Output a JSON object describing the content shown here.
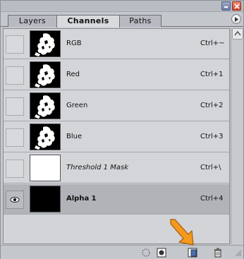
{
  "tabs": [
    {
      "label": "Layers"
    },
    {
      "label": "Channels"
    },
    {
      "label": "Paths"
    }
  ],
  "channels": [
    {
      "name": "RGB",
      "shortcut": "Ctrl+~",
      "thumb": "silhouette"
    },
    {
      "name": "Red",
      "shortcut": "Ctrl+1",
      "thumb": "silhouette"
    },
    {
      "name": "Green",
      "shortcut": "Ctrl+2",
      "thumb": "silhouette"
    },
    {
      "name": "Blue",
      "shortcut": "Ctrl+3",
      "thumb": "silhouette"
    },
    {
      "name": "Threshold 1 Mask",
      "shortcut": "Ctrl+\\",
      "thumb": "white"
    },
    {
      "name": "Alpha 1",
      "shortcut": "Ctrl+4",
      "thumb": "black"
    }
  ],
  "selected_channel": "Alpha 1",
  "icons": {
    "minimize": "minimize-icon",
    "close": "close-icon",
    "menu": "panel-menu-icon",
    "eye": "eye-icon",
    "load": "dotted-circle-icon",
    "save": "square-with-circle-icon",
    "new": "new-channel-icon",
    "delete": "trash-icon",
    "pointer": "orange-arrow-icon"
  },
  "colors": {
    "selected_row": "#b1b3b9",
    "row": "#d3d5d9",
    "arrow": "#f39a1e",
    "close_button": "#d04632",
    "minimize_button": "#6e80a6"
  }
}
